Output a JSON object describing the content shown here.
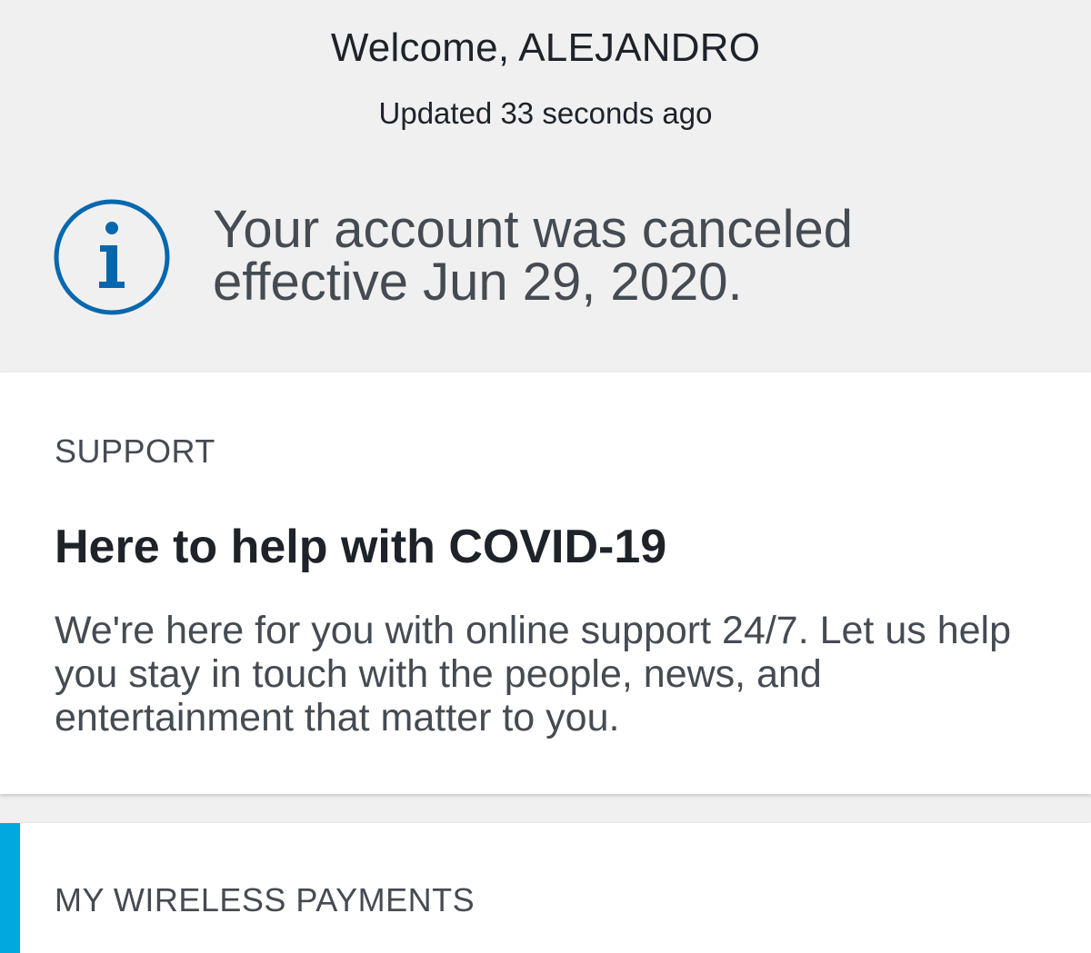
{
  "header": {
    "welcome": "Welcome, ALEJANDRO",
    "updated": "Updated 33 seconds ago"
  },
  "notice": {
    "icon": "info-icon",
    "line1": "Your account was canceled",
    "line2": "effective Jun 29, 2020."
  },
  "support": {
    "eyebrow": "SUPPORT",
    "title": "Here to help with COVID-19",
    "body": "We're here for you with online support 24/7. Let us help you stay in touch with the people, news, and entertainment that matter to you."
  },
  "payments": {
    "eyebrow": "MY WIRELESS PAYMENTS"
  },
  "colors": {
    "background": "#f0f0f1",
    "card": "#ffffff",
    "info_blue": "#0568ae",
    "accent": "#00a8e0",
    "text_dark": "#1d2329",
    "text_muted": "#454b52"
  }
}
